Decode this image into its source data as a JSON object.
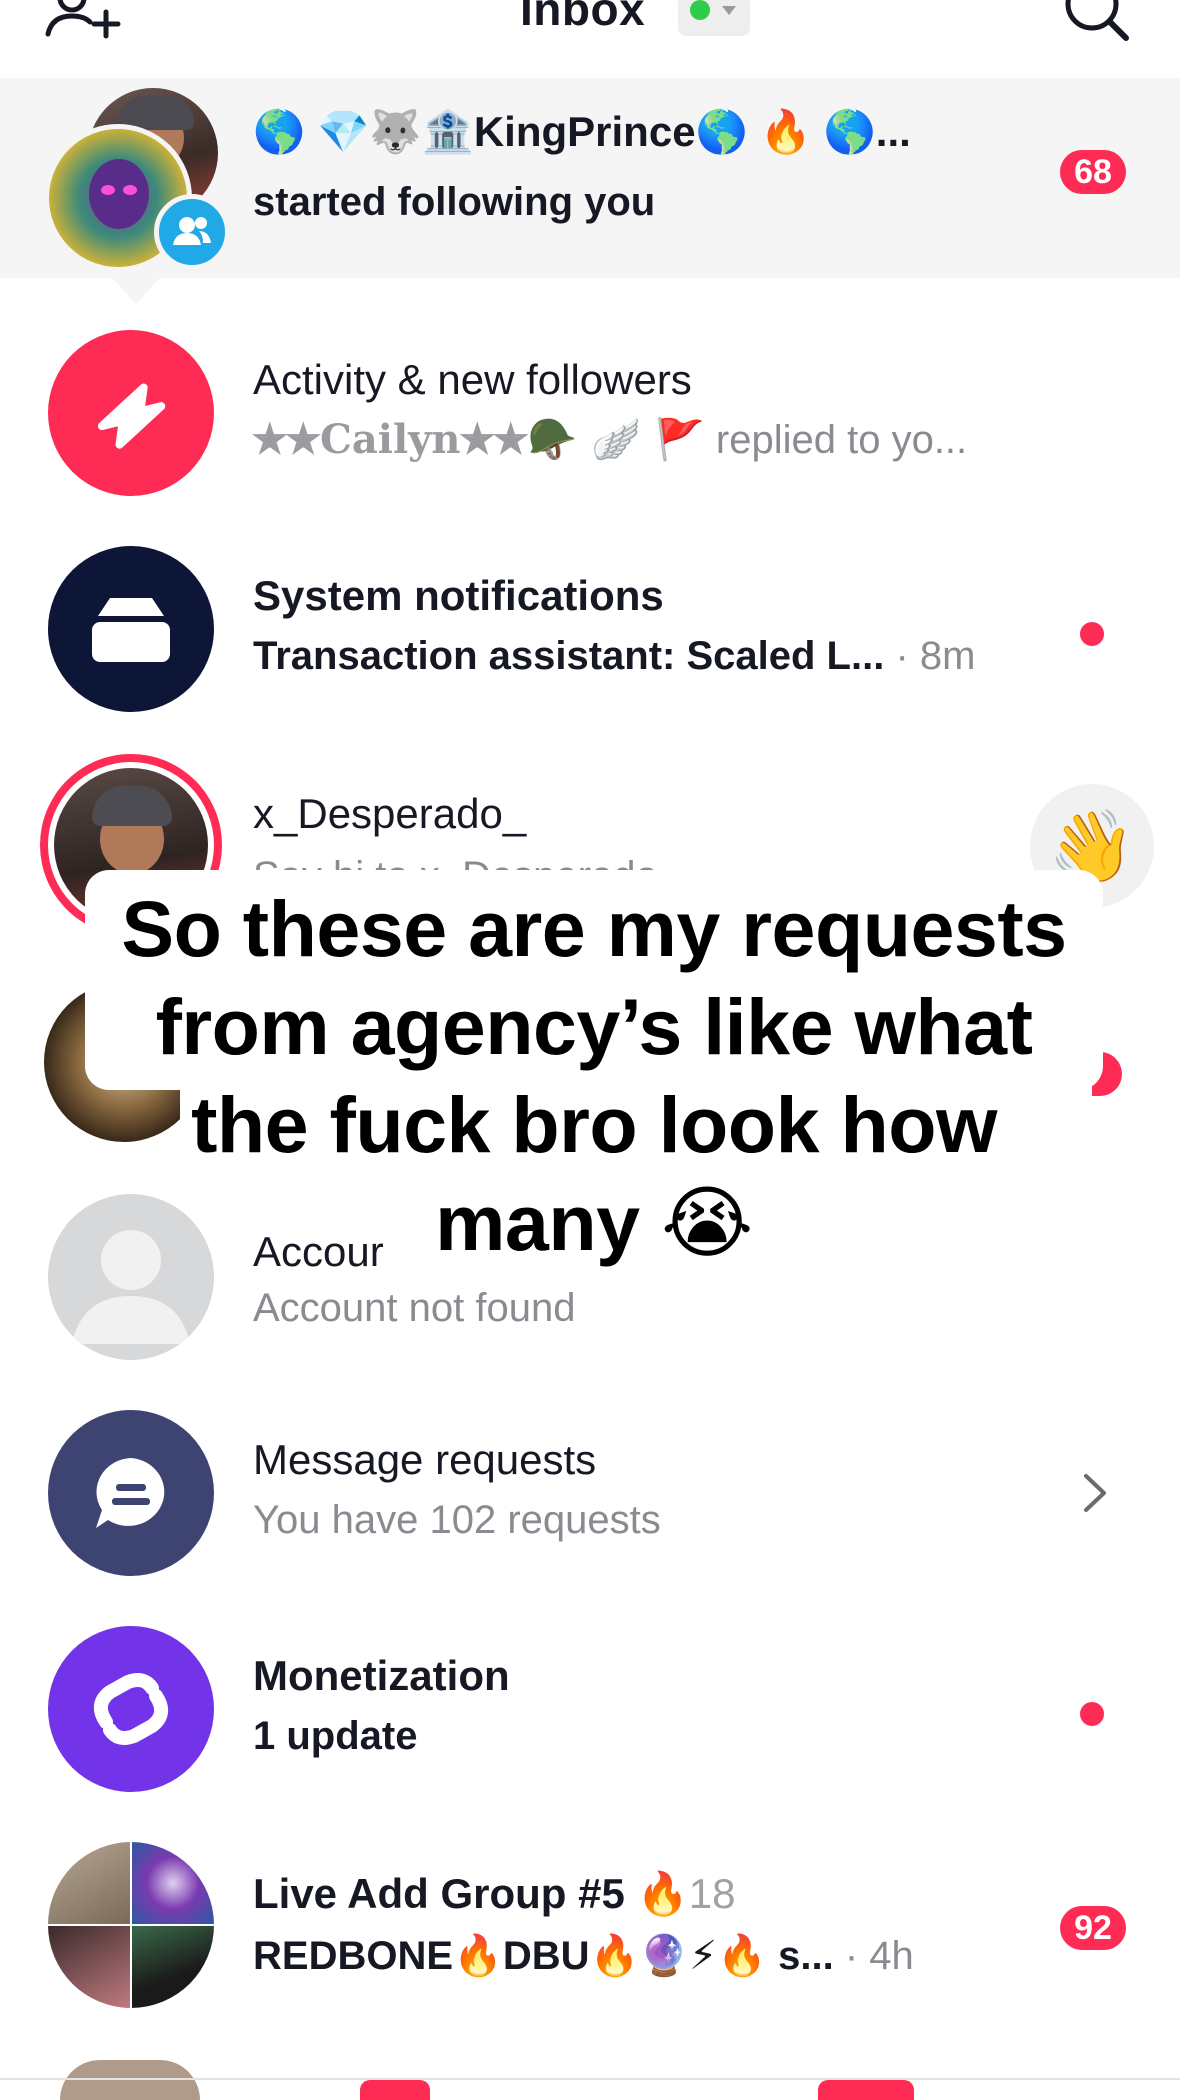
{
  "header": {
    "title": "Inbox",
    "status_color": "#2ecc4a",
    "add_user_icon": "add-user-icon",
    "search_icon": "search-icon"
  },
  "follow_row": {
    "name": "🌎 💎🐺🏦KingPrince🌎 🔥 🌎...",
    "subtitle": "started following you",
    "badge": "68"
  },
  "activity_row": {
    "title": "Activity & new followers",
    "subtitle_name": "✭✭Cailyn✭✭🪖 🪽 🚩",
    "subtitle_text": " replied to yo...",
    "icon_color": "#fe2c55"
  },
  "system_row": {
    "title": "System notifications",
    "subtitle": "Transaction assistant: Scaled L...",
    "time": "· 8m",
    "icon_color": "#0e1638"
  },
  "desperado_row": {
    "title": "x_Desperado_",
    "subtitle": "Say hi to x_Desperado_",
    "wave": "👋"
  },
  "account_row": {
    "title": "Accour",
    "subtitle": "Account not found"
  },
  "requests_row": {
    "title": "Message requests",
    "subtitle": "You have 102 requests",
    "icon_color": "#3d4472"
  },
  "monetization_row": {
    "title": "Monetization",
    "subtitle": "1 update",
    "icon_color": "#7333e8"
  },
  "group_row": {
    "title": "Live Add Group #5",
    "member_count": "18",
    "subtitle": "REDBONE🔥DBU🔥🔮⚡🔥 s...",
    "time": "· 4h",
    "badge": "92"
  },
  "caption": {
    "lines": [
      "So these are my requests",
      "from agency’s like what",
      "the fuck bro look how",
      "many 😭"
    ]
  }
}
